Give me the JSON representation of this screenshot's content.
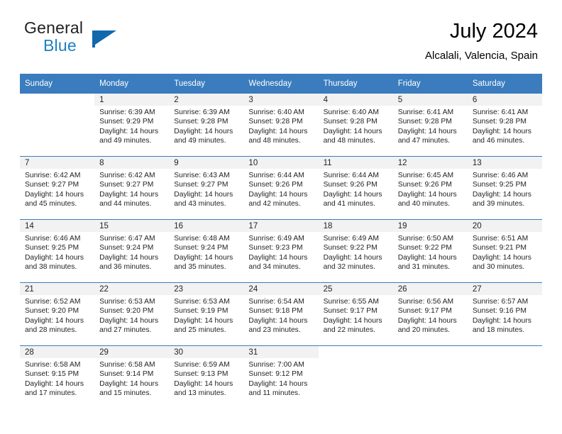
{
  "brand": {
    "name_part1": "General",
    "name_part2": "Blue",
    "flag_color": "#1168ad"
  },
  "header": {
    "title": "July 2024",
    "subtitle": "Alcalali, Valencia, Spain",
    "header_bg_color": "#3a7cbe",
    "daynum_bg_color": "#f2f2f2"
  },
  "weekdays": [
    "Sunday",
    "Monday",
    "Tuesday",
    "Wednesday",
    "Thursday",
    "Friday",
    "Saturday"
  ],
  "weeks": [
    [
      {
        "day": "",
        "lines": []
      },
      {
        "day": "1",
        "lines": [
          "Sunrise: 6:39 AM",
          "Sunset: 9:29 PM",
          "Daylight: 14 hours",
          "and 49 minutes."
        ]
      },
      {
        "day": "2",
        "lines": [
          "Sunrise: 6:39 AM",
          "Sunset: 9:28 PM",
          "Daylight: 14 hours",
          "and 49 minutes."
        ]
      },
      {
        "day": "3",
        "lines": [
          "Sunrise: 6:40 AM",
          "Sunset: 9:28 PM",
          "Daylight: 14 hours",
          "and 48 minutes."
        ]
      },
      {
        "day": "4",
        "lines": [
          "Sunrise: 6:40 AM",
          "Sunset: 9:28 PM",
          "Daylight: 14 hours",
          "and 48 minutes."
        ]
      },
      {
        "day": "5",
        "lines": [
          "Sunrise: 6:41 AM",
          "Sunset: 9:28 PM",
          "Daylight: 14 hours",
          "and 47 minutes."
        ]
      },
      {
        "day": "6",
        "lines": [
          "Sunrise: 6:41 AM",
          "Sunset: 9:28 PM",
          "Daylight: 14 hours",
          "and 46 minutes."
        ]
      }
    ],
    [
      {
        "day": "7",
        "lines": [
          "Sunrise: 6:42 AM",
          "Sunset: 9:27 PM",
          "Daylight: 14 hours",
          "and 45 minutes."
        ]
      },
      {
        "day": "8",
        "lines": [
          "Sunrise: 6:42 AM",
          "Sunset: 9:27 PM",
          "Daylight: 14 hours",
          "and 44 minutes."
        ]
      },
      {
        "day": "9",
        "lines": [
          "Sunrise: 6:43 AM",
          "Sunset: 9:27 PM",
          "Daylight: 14 hours",
          "and 43 minutes."
        ]
      },
      {
        "day": "10",
        "lines": [
          "Sunrise: 6:44 AM",
          "Sunset: 9:26 PM",
          "Daylight: 14 hours",
          "and 42 minutes."
        ]
      },
      {
        "day": "11",
        "lines": [
          "Sunrise: 6:44 AM",
          "Sunset: 9:26 PM",
          "Daylight: 14 hours",
          "and 41 minutes."
        ]
      },
      {
        "day": "12",
        "lines": [
          "Sunrise: 6:45 AM",
          "Sunset: 9:26 PM",
          "Daylight: 14 hours",
          "and 40 minutes."
        ]
      },
      {
        "day": "13",
        "lines": [
          "Sunrise: 6:46 AM",
          "Sunset: 9:25 PM",
          "Daylight: 14 hours",
          "and 39 minutes."
        ]
      }
    ],
    [
      {
        "day": "14",
        "lines": [
          "Sunrise: 6:46 AM",
          "Sunset: 9:25 PM",
          "Daylight: 14 hours",
          "and 38 minutes."
        ]
      },
      {
        "day": "15",
        "lines": [
          "Sunrise: 6:47 AM",
          "Sunset: 9:24 PM",
          "Daylight: 14 hours",
          "and 36 minutes."
        ]
      },
      {
        "day": "16",
        "lines": [
          "Sunrise: 6:48 AM",
          "Sunset: 9:24 PM",
          "Daylight: 14 hours",
          "and 35 minutes."
        ]
      },
      {
        "day": "17",
        "lines": [
          "Sunrise: 6:49 AM",
          "Sunset: 9:23 PM",
          "Daylight: 14 hours",
          "and 34 minutes."
        ]
      },
      {
        "day": "18",
        "lines": [
          "Sunrise: 6:49 AM",
          "Sunset: 9:22 PM",
          "Daylight: 14 hours",
          "and 32 minutes."
        ]
      },
      {
        "day": "19",
        "lines": [
          "Sunrise: 6:50 AM",
          "Sunset: 9:22 PM",
          "Daylight: 14 hours",
          "and 31 minutes."
        ]
      },
      {
        "day": "20",
        "lines": [
          "Sunrise: 6:51 AM",
          "Sunset: 9:21 PM",
          "Daylight: 14 hours",
          "and 30 minutes."
        ]
      }
    ],
    [
      {
        "day": "21",
        "lines": [
          "Sunrise: 6:52 AM",
          "Sunset: 9:20 PM",
          "Daylight: 14 hours",
          "and 28 minutes."
        ]
      },
      {
        "day": "22",
        "lines": [
          "Sunrise: 6:53 AM",
          "Sunset: 9:20 PM",
          "Daylight: 14 hours",
          "and 27 minutes."
        ]
      },
      {
        "day": "23",
        "lines": [
          "Sunrise: 6:53 AM",
          "Sunset: 9:19 PM",
          "Daylight: 14 hours",
          "and 25 minutes."
        ]
      },
      {
        "day": "24",
        "lines": [
          "Sunrise: 6:54 AM",
          "Sunset: 9:18 PM",
          "Daylight: 14 hours",
          "and 23 minutes."
        ]
      },
      {
        "day": "25",
        "lines": [
          "Sunrise: 6:55 AM",
          "Sunset: 9:17 PM",
          "Daylight: 14 hours",
          "and 22 minutes."
        ]
      },
      {
        "day": "26",
        "lines": [
          "Sunrise: 6:56 AM",
          "Sunset: 9:17 PM",
          "Daylight: 14 hours",
          "and 20 minutes."
        ]
      },
      {
        "day": "27",
        "lines": [
          "Sunrise: 6:57 AM",
          "Sunset: 9:16 PM",
          "Daylight: 14 hours",
          "and 18 minutes."
        ]
      }
    ],
    [
      {
        "day": "28",
        "lines": [
          "Sunrise: 6:58 AM",
          "Sunset: 9:15 PM",
          "Daylight: 14 hours",
          "and 17 minutes."
        ]
      },
      {
        "day": "29",
        "lines": [
          "Sunrise: 6:58 AM",
          "Sunset: 9:14 PM",
          "Daylight: 14 hours",
          "and 15 minutes."
        ]
      },
      {
        "day": "30",
        "lines": [
          "Sunrise: 6:59 AM",
          "Sunset: 9:13 PM",
          "Daylight: 14 hours",
          "and 13 minutes."
        ]
      },
      {
        "day": "31",
        "lines": [
          "Sunrise: 7:00 AM",
          "Sunset: 9:12 PM",
          "Daylight: 14 hours",
          "and 11 minutes."
        ]
      },
      {
        "day": "",
        "lines": []
      },
      {
        "day": "",
        "lines": []
      },
      {
        "day": "",
        "lines": []
      }
    ]
  ]
}
